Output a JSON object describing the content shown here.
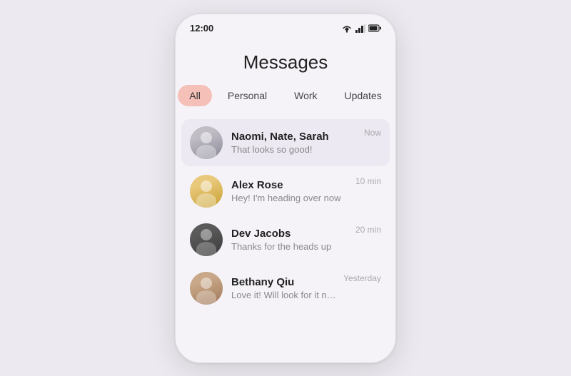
{
  "phone": {
    "status_bar": {
      "time": "12:00"
    },
    "title": "Messages",
    "tabs": [
      {
        "id": "all",
        "label": "All",
        "active": true
      },
      {
        "id": "personal",
        "label": "Personal",
        "active": false
      },
      {
        "id": "work",
        "label": "Work",
        "active": false
      },
      {
        "id": "updates",
        "label": "Updates",
        "active": false
      }
    ],
    "messages": [
      {
        "id": "msg1",
        "name": "Naomi, Nate, Sarah",
        "preview": "That looks so good!",
        "time": "Now",
        "avatar_color": "av1"
      },
      {
        "id": "msg2",
        "name": "Alex Rose",
        "preview": "Hey! I'm heading over now",
        "time": "10 min",
        "avatar_color": "av2"
      },
      {
        "id": "msg3",
        "name": "Dev Jacobs",
        "preview": "Thanks for the heads up",
        "time": "20 min",
        "avatar_color": "av3"
      },
      {
        "id": "msg4",
        "name": "Bethany Qiu",
        "preview": "Love it! Will look for it now",
        "time": "Yesterday",
        "avatar_color": "av4"
      }
    ]
  }
}
